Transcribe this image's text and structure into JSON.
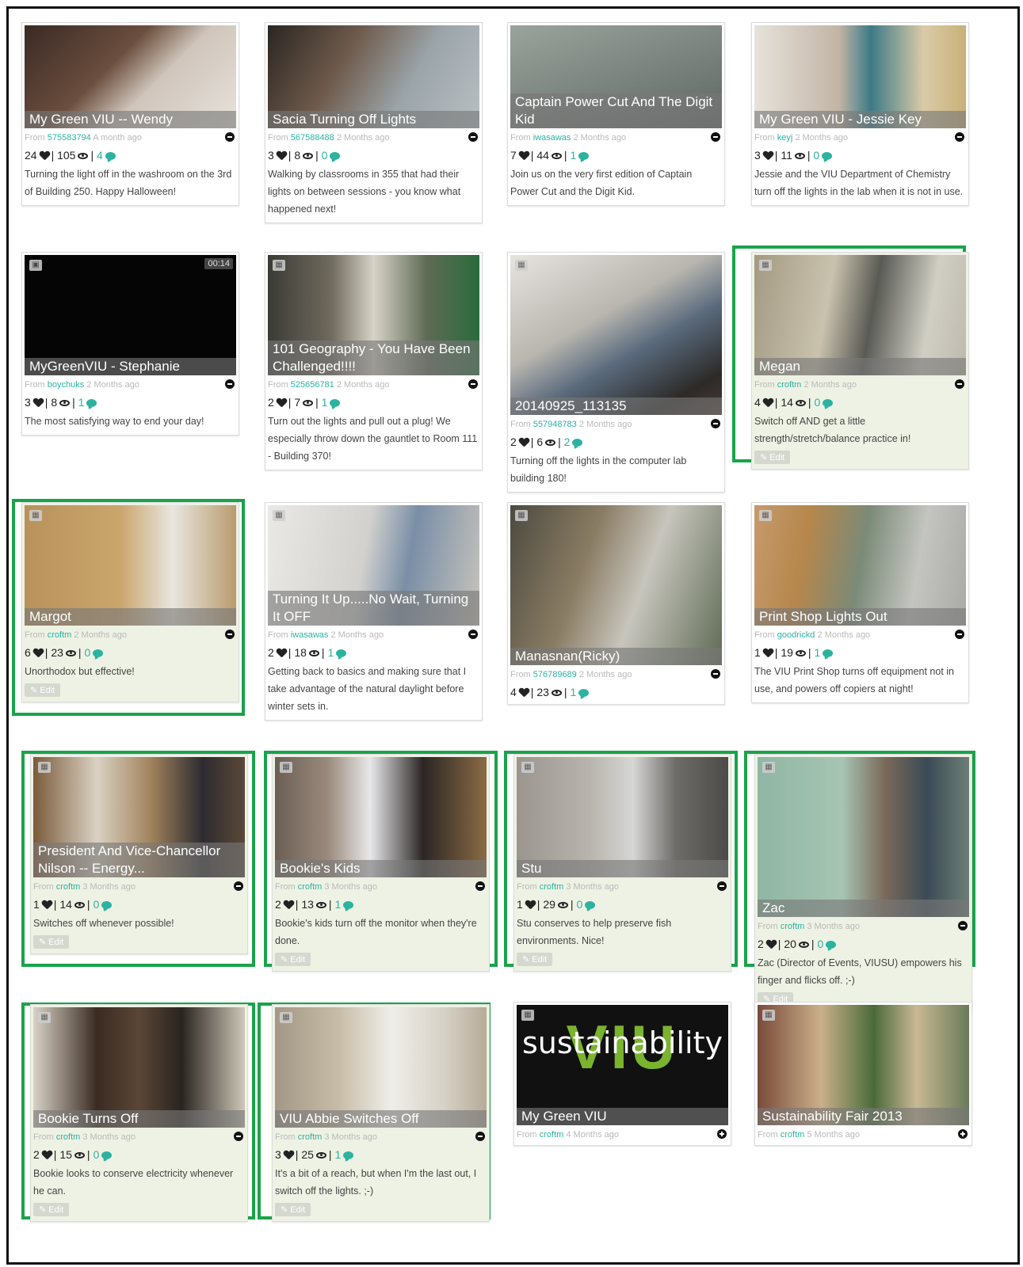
{
  "colors": {
    "accent": "#2bb3a0",
    "highlight_border": "#1aa34a",
    "highlight_bg": "#eef2e4"
  },
  "icons": {
    "photo": "image-icon",
    "video": "video-icon",
    "like": "heart-icon",
    "views": "eye-icon",
    "comments": "comment-icon",
    "collapse": "minus-circle-icon",
    "expand": "plus-circle-icon",
    "edit": "pencil-icon"
  },
  "common": {
    "from": "From",
    "edit": "✎ Edit"
  },
  "cards": [
    {
      "title": "My Green VIU -- Wendy",
      "user": "575583794",
      "time": "A month ago",
      "likes": "24",
      "views": "105",
      "comments": "4",
      "desc": "Turning the light off in the washroom on the 3rd of Building 250. Happy Halloween!"
    },
    {
      "title": "Sacia Turning Off Lights",
      "user": "567588488",
      "time": "2 Months ago",
      "likes": "3",
      "views": "8",
      "comments": "0",
      "desc": "Walking by classrooms in 355 that had their lights on between sessions - you know what happened next!"
    },
    {
      "title": "Captain Power Cut And The Digit Kid",
      "user": "iwasawas",
      "time": "2 Months ago",
      "likes": "7",
      "views": "44",
      "comments": "1",
      "desc": "Join us on the very first edition of Captain Power Cut and the Digit Kid."
    },
    {
      "title": "My Green VIU - Jessie Key",
      "user": "keyj",
      "time": "2 Months ago",
      "likes": "3",
      "views": "11",
      "comments": "0",
      "desc": "Jessie and the VIU Department of Chemistry turn off the lights in the lab when it is not in use."
    },
    {
      "title": "MyGreenVIU - Stephanie",
      "user": "boychuks",
      "time": "2 Months ago",
      "likes": "3",
      "views": "8",
      "comments": "1",
      "desc": "The most satisfying way to end your day!",
      "duration": "00:14"
    },
    {
      "title": "101 Geography - You Have Been Challenged!!!!",
      "user": "525656781",
      "time": "2 Months ago",
      "likes": "2",
      "views": "7",
      "comments": "1",
      "desc": "Turn out the lights and pull out a plug! We especially throw down the gauntlet to Room 111 - Building 370!"
    },
    {
      "title": "20140925_113135",
      "user": "557948783",
      "time": "2 Months ago",
      "likes": "2",
      "views": "6",
      "comments": "2",
      "desc": "Turning off the lights in the computer lab building 180!"
    },
    {
      "title": "Megan",
      "user": "croftm",
      "time": "2 Months ago",
      "likes": "4",
      "views": "14",
      "comments": "0",
      "desc": "Switch off AND get a little strength/stretch/balance practice in!"
    },
    {
      "title": "Margot",
      "user": "croftm",
      "time": "2 Months ago",
      "likes": "6",
      "views": "23",
      "comments": "0",
      "desc": "Unorthodox but effective!"
    },
    {
      "title": "Turning It Up.....No Wait, Turning It OFF",
      "user": "iwasawas",
      "time": "2 Months ago",
      "likes": "2",
      "views": "18",
      "comments": "1",
      "desc": "Getting back to basics and making sure that I take advantage of the natural daylight before winter sets in."
    },
    {
      "title": "Manasnan(Ricky)",
      "user": "576789689",
      "time": "2 Months ago",
      "likes": "4",
      "views": "23",
      "comments": "1",
      "desc": ""
    },
    {
      "title": "Print Shop Lights Out",
      "user": "goodrickd",
      "time": "2 Months ago",
      "likes": "1",
      "views": "19",
      "comments": "1",
      "desc": "The VIU Print Shop turns off equipment not in use, and powers off copiers at night!"
    },
    {
      "title": "President And Vice-Chancellor Nilson -- Energy...",
      "user": "croftm",
      "time": "3 Months ago",
      "likes": "1",
      "views": "14",
      "comments": "0",
      "desc": "Switches off whenever possible!"
    },
    {
      "title": "Bookie's Kids",
      "user": "croftm",
      "time": "3 Months ago",
      "likes": "2",
      "views": "13",
      "comments": "1",
      "desc": "Bookie's kids turn off the monitor when they're done."
    },
    {
      "title": "Stu",
      "user": "croftm",
      "time": "3 Months ago",
      "likes": "1",
      "views": "29",
      "comments": "0",
      "desc": "Stu conserves to help preserve fish environments. Nice!"
    },
    {
      "title": "Zac",
      "user": "croftm",
      "time": "3 Months ago",
      "likes": "2",
      "views": "20",
      "comments": "0",
      "desc": "Zac (Director of Events, VIUSU) empowers his finger and flicks off. ;-)"
    },
    {
      "title": "Bookie Turns Off",
      "user": "croftm",
      "time": "3 Months ago",
      "likes": "2",
      "views": "15",
      "comments": "0",
      "desc": "Bookie looks to conserve electricity whenever he can."
    },
    {
      "title": "VIU Abbie Switches Off",
      "user": "croftm",
      "time": "3 Months ago",
      "likes": "3",
      "views": "25",
      "comments": "1",
      "desc": "It's a bit of a reach, but when I'm the last out, I switch off the lights. ;-)"
    },
    {
      "title": "My Green VIU",
      "user": "croftm",
      "time": "4 Months ago",
      "logo_text": "sustainability",
      "logo_letters": "VIU"
    },
    {
      "title": "Sustainability Fair 2013",
      "user": "croftm",
      "time": "5 Months ago"
    }
  ]
}
